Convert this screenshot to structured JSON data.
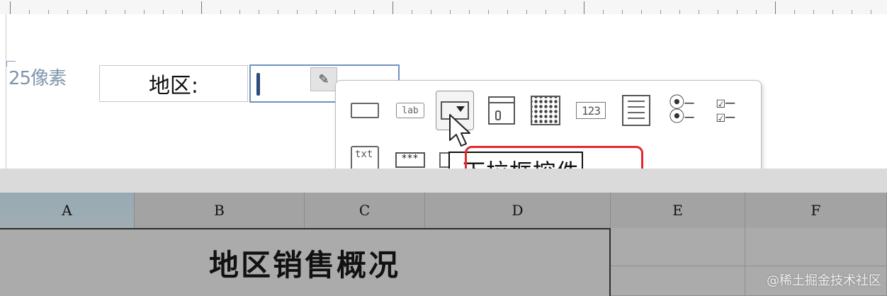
{
  "designer": {
    "row_height_label": "25像素",
    "field_label": "地区:",
    "field_value": "",
    "edit_icon": "edit-pen-icon"
  },
  "palette": {
    "icons": [
      "text-box-icon",
      "label-icon",
      "combo-box-icon",
      "date-picker-icon",
      "calendar-icon",
      "number-icon",
      "textarea-icon",
      "radio-group-icon",
      "checkbox-group-icon",
      "txt-upload-icon",
      "password-icon",
      "partial-icon"
    ],
    "label_icon_text": "lab",
    "number_icon_text": "123",
    "txt_icon_text": "txt",
    "password_icon_text": "***",
    "tooltip": "下拉框控件"
  },
  "sheet": {
    "columns": [
      "A",
      "B",
      "C",
      "D",
      "E",
      "F"
    ],
    "title": "地区销售概况"
  },
  "watermark": "@稀土掘金技术社区",
  "colors": {
    "highlight": "#e5282b",
    "input_border": "#6f93c3",
    "header_gray": "#a3a3a3"
  }
}
